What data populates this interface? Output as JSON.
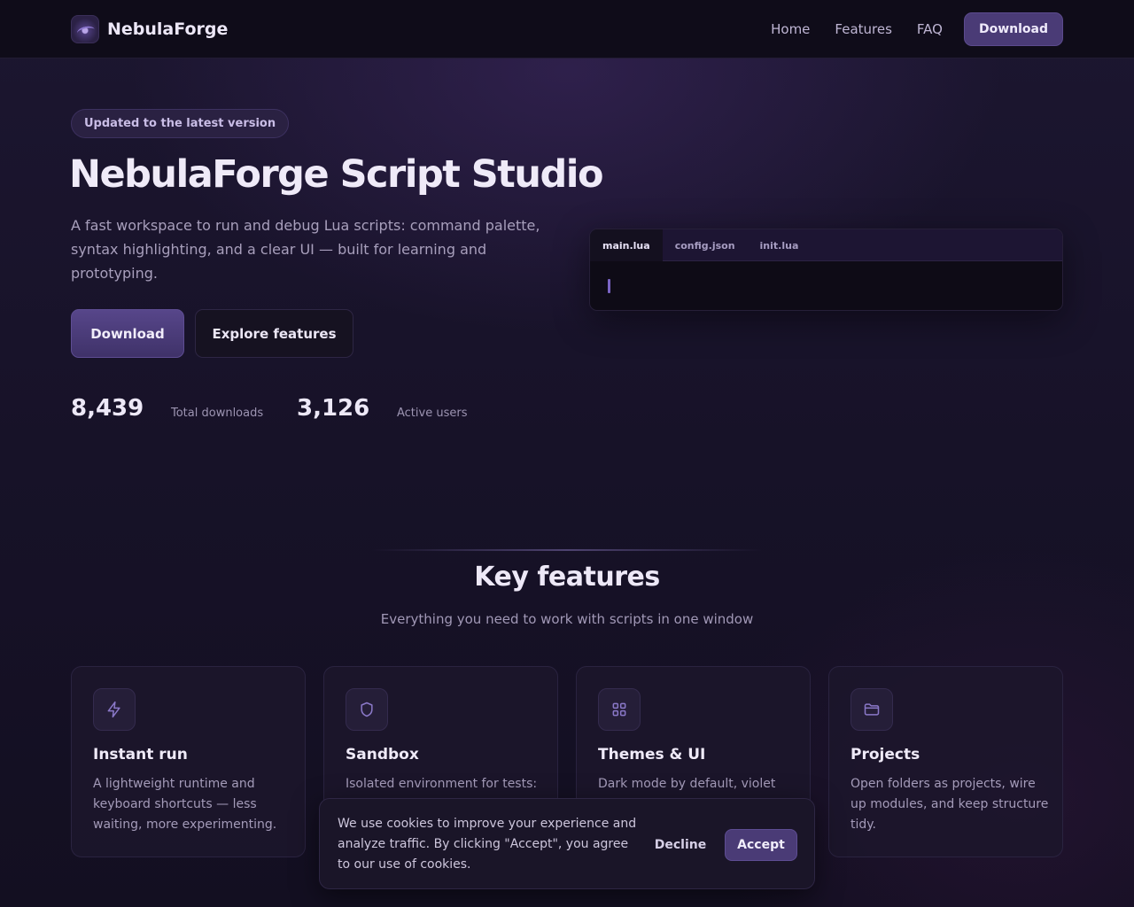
{
  "nav": {
    "brand": "NebulaForge",
    "links": [
      "Home",
      "Features",
      "FAQ"
    ],
    "cta": "Download"
  },
  "hero": {
    "badge": "Updated to the latest version",
    "title": "NebulaForge Script Studio",
    "subtitle": "A fast workspace to run and debug Lua scripts: command palette, syntax highlighting, and a clear UI — built for learning and prototyping.",
    "primary_button": "Download",
    "secondary_button": "Explore features",
    "stats": [
      {
        "value": "8,439",
        "label": "Total downloads"
      },
      {
        "value": "3,126",
        "label": "Active users"
      }
    ]
  },
  "editor": {
    "tabs": [
      "main.lua",
      "config.json",
      "init.lua"
    ],
    "active_tab": "main.lua"
  },
  "features": {
    "title": "Key features",
    "subtitle": "Everything you need to work with scripts in one window",
    "cards": [
      {
        "icon": "lightning-icon",
        "title": "Instant run",
        "description": "A lightweight runtime and keyboard shortcuts — less waiting, more experimenting."
      },
      {
        "icon": "shield-icon",
        "title": "Sandbox",
        "description": "Isolated environment for tests:"
      },
      {
        "icon": "grid-icon",
        "title": "Themes & UI",
        "description": "Dark mode by default, violet"
      },
      {
        "icon": "folder-icon",
        "title": "Projects",
        "description": "Open folders as projects, wire up modules, and keep structure tidy."
      }
    ]
  },
  "cookie": {
    "text": "We use cookies to improve your experience and analyze traffic. By clicking \"Accept\", you agree to our use of cookies.",
    "decline": "Decline",
    "accept": "Accept"
  },
  "colors": {
    "accent": "#4a3b76",
    "background": "#171228"
  }
}
